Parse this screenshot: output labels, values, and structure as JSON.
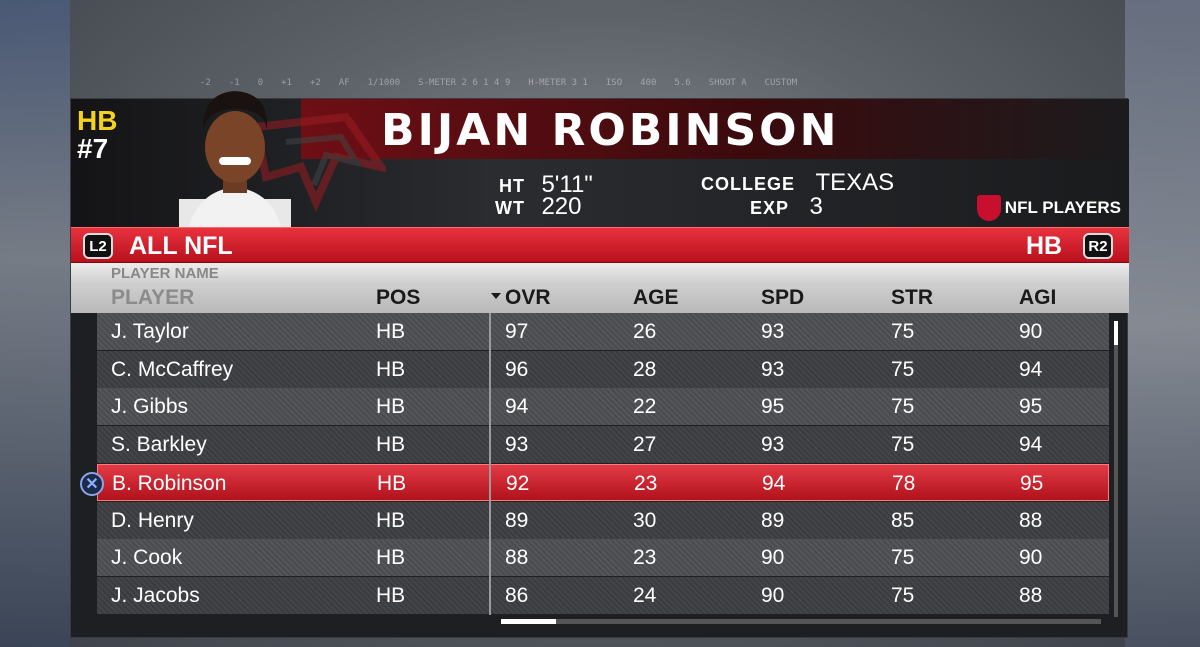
{
  "hud": {
    "items": [
      "-2",
      "-1",
      "0",
      "+1",
      "+2",
      "AF",
      "1/1000",
      "S-METER 2 6 1 4 9",
      "H-METER 3 1",
      "ISO",
      "400",
      "5.6",
      "SHOOT A",
      "CUSTOM"
    ]
  },
  "player": {
    "position": "HB",
    "number": "#7",
    "name": "BIJAN ROBINSON",
    "ht_label": "HT",
    "ht": "5'11\"",
    "wt_label": "WT",
    "wt": "220",
    "college_label": "COLLEGE",
    "college": "TEXAS",
    "exp_label": "EXP",
    "exp": "3"
  },
  "brand": "NFL PLAYERS",
  "filter": {
    "left_btn": "L2",
    "left_text": "ALL NFL",
    "right_text": "HB",
    "right_btn": "R2"
  },
  "subheader": "PLAYER NAME",
  "columns": [
    "PLAYER",
    "POS",
    "OVR",
    "AGE",
    "SPD",
    "STR",
    "AGI"
  ],
  "rows": [
    {
      "name": "J. Taylor",
      "pos": "HB",
      "ovr": "97",
      "age": "26",
      "spd": "93",
      "str": "75",
      "agi": "90"
    },
    {
      "name": "C. McCaffrey",
      "pos": "HB",
      "ovr": "96",
      "age": "28",
      "spd": "93",
      "str": "75",
      "agi": "94"
    },
    {
      "name": "J. Gibbs",
      "pos": "HB",
      "ovr": "94",
      "age": "22",
      "spd": "95",
      "str": "75",
      "agi": "95"
    },
    {
      "name": "S. Barkley",
      "pos": "HB",
      "ovr": "93",
      "age": "27",
      "spd": "93",
      "str": "75",
      "agi": "94"
    },
    {
      "name": "B. Robinson",
      "pos": "HB",
      "ovr": "92",
      "age": "23",
      "spd": "94",
      "str": "78",
      "agi": "95"
    },
    {
      "name": "D. Henry",
      "pos": "HB",
      "ovr": "89",
      "age": "30",
      "spd": "89",
      "str": "85",
      "agi": "88"
    },
    {
      "name": "J. Cook",
      "pos": "HB",
      "ovr": "88",
      "age": "23",
      "spd": "90",
      "str": "75",
      "agi": "90"
    },
    {
      "name": "J. Jacobs",
      "pos": "HB",
      "ovr": "86",
      "age": "24",
      "spd": "90",
      "str": "75",
      "agi": "88"
    }
  ],
  "selected_row": 4,
  "select_button": "✕",
  "colors": {
    "accent_red": "#c8102e",
    "position_yellow": "#f3d31b"
  }
}
